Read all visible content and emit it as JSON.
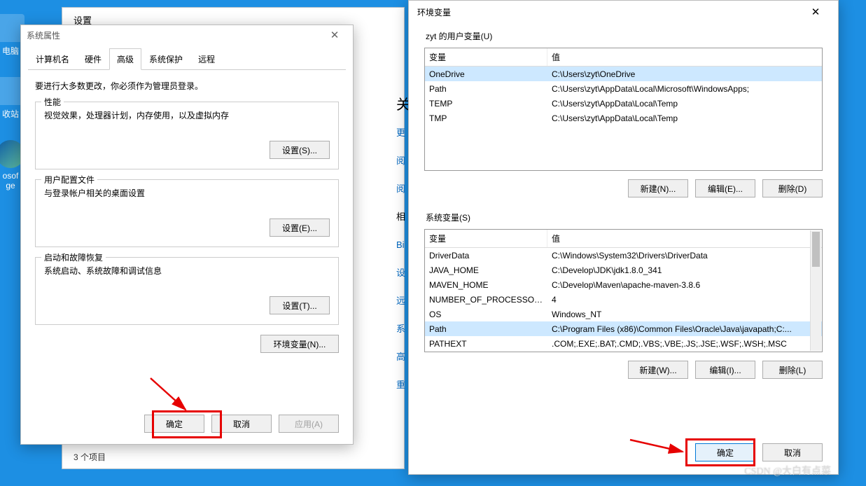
{
  "desktop": {
    "icons": [
      {
        "label": "电脑"
      },
      {
        "label": "收站"
      },
      {
        "label": "osof"
      },
      {
        "label": "ge"
      }
    ]
  },
  "settings_window": {
    "title": "设置",
    "关": "关",
    "items_count": "3 个项目",
    "links": [
      "更",
      "阅",
      "阅",
      "相",
      "Bi",
      "设",
      "远",
      "系",
      "高",
      "重"
    ]
  },
  "sysprop": {
    "title": "系统属性",
    "tabs": [
      "计算机名",
      "硬件",
      "高级",
      "系统保护",
      "远程"
    ],
    "active_tab_index": 2,
    "note": "要进行大多数更改，你必须作为管理员登录。",
    "groups": [
      {
        "legend": "性能",
        "desc": "视觉效果，处理器计划，内存使用，以及虚拟内存",
        "button": "设置(S)..."
      },
      {
        "legend": "用户配置文件",
        "desc": "与登录帐户相关的桌面设置",
        "button": "设置(E)..."
      },
      {
        "legend": "启动和故障恢复",
        "desc": "系统启动、系统故障和调试信息",
        "button": "设置(T)..."
      }
    ],
    "env_button": "环境变量(N)...",
    "ok": "确定",
    "cancel": "取消",
    "apply": "应用(A)"
  },
  "envvar": {
    "title": "环境变量",
    "user_section": "zyt 的用户变量(U)",
    "sys_section": "系统变量(S)",
    "col_var": "变量",
    "col_val": "值",
    "user_vars": [
      {
        "name": "OneDrive",
        "value": "C:\\Users\\zyt\\OneDrive",
        "sel": true
      },
      {
        "name": "Path",
        "value": "C:\\Users\\zyt\\AppData\\Local\\Microsoft\\WindowsApps;"
      },
      {
        "name": "TEMP",
        "value": "C:\\Users\\zyt\\AppData\\Local\\Temp"
      },
      {
        "name": "TMP",
        "value": "C:\\Users\\zyt\\AppData\\Local\\Temp"
      }
    ],
    "sys_vars": [
      {
        "name": "DriverData",
        "value": "C:\\Windows\\System32\\Drivers\\DriverData"
      },
      {
        "name": "JAVA_HOME",
        "value": "C:\\Develop\\JDK\\jdk1.8.0_341"
      },
      {
        "name": "MAVEN_HOME",
        "value": "C:\\Develop\\Maven\\apache-maven-3.8.6"
      },
      {
        "name": "NUMBER_OF_PROCESSORS",
        "value": "4"
      },
      {
        "name": "OS",
        "value": "Windows_NT"
      },
      {
        "name": "Path",
        "value": "C:\\Program Files (x86)\\Common Files\\Oracle\\Java\\javapath;C:...",
        "sel": true
      },
      {
        "name": "PATHEXT",
        "value": ".COM;.EXE;.BAT;.CMD;.VBS;.VBE;.JS;.JSE;.WSF;.WSH;.MSC"
      }
    ],
    "new_btn_u": "新建(N)...",
    "edit_btn_u": "编辑(E)...",
    "del_btn_u": "删除(D)",
    "new_btn_s": "新建(W)...",
    "edit_btn_s": "编辑(I)...",
    "del_btn_s": "删除(L)",
    "ok": "确定",
    "cancel": "取消"
  },
  "watermark": "CSDN @大白有点菜"
}
